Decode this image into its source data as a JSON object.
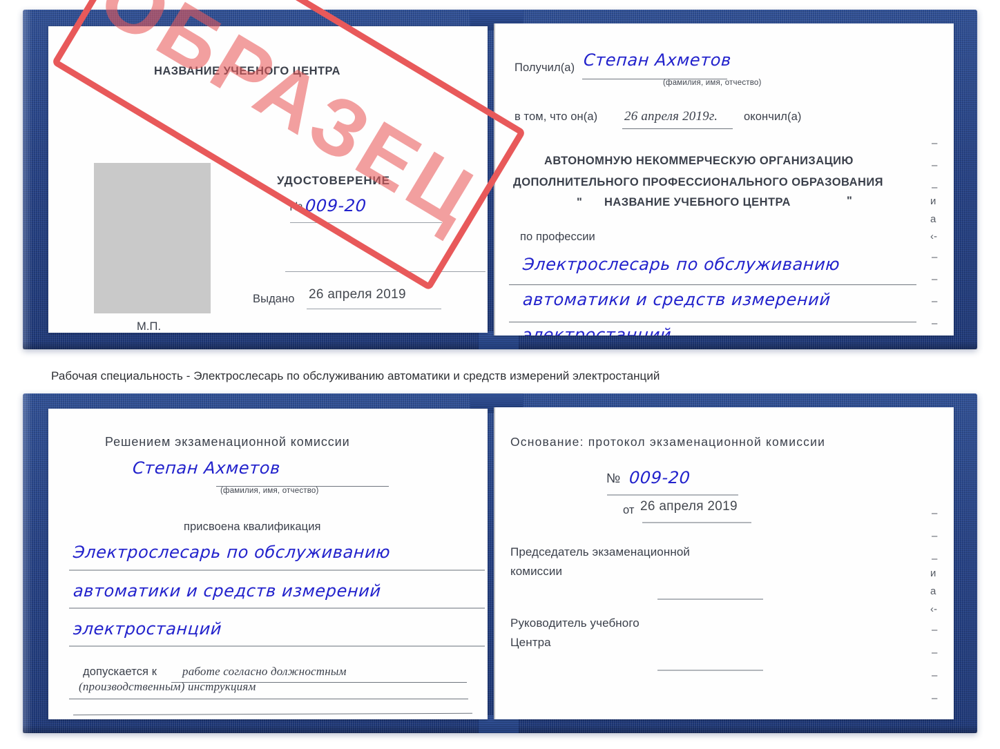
{
  "document": {
    "type": "certificate",
    "watermark": "ОБРАЗЕЦ",
    "accent_blue_cover": "#27437f",
    "handwriting_color": "#2222cc",
    "stamp_color": "#e8595a"
  },
  "caption": {
    "text": "Рабочая специальность - Электрослесарь по обслуживанию автоматики и средств измерений электростанций"
  },
  "cert_top": {
    "left_page": {
      "center_name": "НАЗВАНИЕ УЧЕБНОГО ЦЕНТРА",
      "title": "УДОСТОВЕРЕНИЕ",
      "number_label": "№",
      "number_value": "009-20",
      "issued_label": "Выдано",
      "issued_value": "26 апреля 2019",
      "seal_label": "М.П.",
      "photo_placeholder": "photo-area"
    },
    "right_page": {
      "received_label": "Получил(а)",
      "received_value": "Степан Ахметов",
      "received_hint": "(фамилия, имя, отчество)",
      "in_that_label": "в том, что он(а)",
      "in_that_value": "26 апреля 2019г.",
      "finished_label": "окончил(а)",
      "org_line1": "АВТОНОМНУЮ НЕКОММЕРЧЕСКУЮ ОРГАНИЗАЦИЮ",
      "org_line2": "ДОПОЛНИТЕЛЬНОГО ПРОФЕССИОНАЛЬНОГО ОБРАЗОВАНИЯ",
      "org_quote_open": "\"",
      "org_line3": "НАЗВАНИЕ УЧЕБНОГО ЦЕНТРА",
      "org_quote_close": "\"",
      "profession_label": "по профессии",
      "profession_line1": "Электрослесарь по обслуживанию",
      "profession_line2": "автоматики и средств измерений",
      "profession_line3": "электростанций",
      "edge_fragments": [
        "–",
        "–",
        "–",
        "и",
        "а",
        "‹-",
        "–",
        "–",
        "–",
        "–"
      ]
    }
  },
  "cert_bottom": {
    "left_page": {
      "decision_title": "Решением экзаменационной комиссии",
      "name_value": "Степан Ахметов",
      "name_hint": "(фамилия, имя, отчество)",
      "qualification_label": "присвоена квалификация",
      "qualification_line1": "Электрослесарь по обслуживанию",
      "qualification_line2": "автоматики и средств измерений",
      "qualification_line3": "электростанций",
      "admitted_label": "допускается к",
      "admitted_value_line1": "работе согласно должностным",
      "admitted_value_line2": "(производственным) инструкциям"
    },
    "right_page": {
      "basis_label": "Основание: протокол экзаменационной комиссии",
      "number_label": "№",
      "number_value": "009-20",
      "from_label": "от",
      "from_value": "26 апреля 2019",
      "chairman_line1": "Председатель экзаменационной",
      "chairman_line2": "комиссии",
      "head_line1": "Руководитель учебного",
      "head_line2": "Центра",
      "edge_fragments": [
        "–",
        "–",
        "–",
        "и",
        "а",
        "‹-",
        "–",
        "–",
        "–",
        "–"
      ]
    }
  }
}
